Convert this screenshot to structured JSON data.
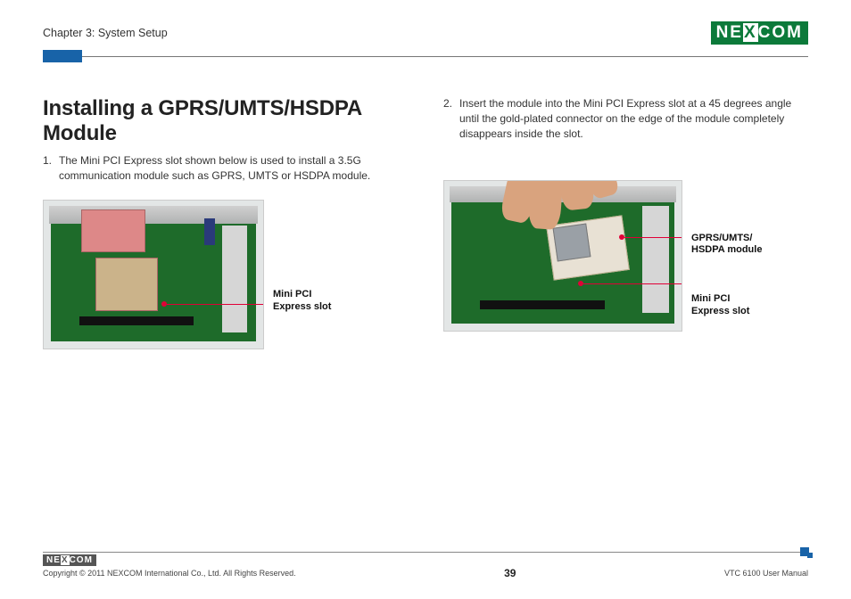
{
  "header": {
    "chapter": "Chapter 3: System Setup",
    "logo_left": "NE",
    "logo_x": "X",
    "logo_right": "COM"
  },
  "title": "Installing a GPRS/UMTS/HSDPA Module",
  "steps": [
    {
      "num": "1.",
      "text": "The Mini PCI Express slot shown below is used to install a 3.5G communication module such as GPRS, UMTS or HSDPA module."
    },
    {
      "num": "2.",
      "text": "Insert the module into the Mini PCI Express slot at a 45 degrees angle until the gold-plated connector on the edge of the module completely disappears inside the slot."
    }
  ],
  "callouts_fig1": {
    "slot": "Mini PCI\nExpress slot"
  },
  "callouts_fig2": {
    "module": "GPRS/UMTS/\nHSDPA module",
    "slot": "Mini PCI\nExpress slot"
  },
  "footer": {
    "copyright": "Copyright © 2011 NEXCOM International Co., Ltd. All Rights Reserved.",
    "page": "39",
    "doc": "VTC 6100 User Manual",
    "logo_left": "NE",
    "logo_x": "X",
    "logo_right": "COM"
  }
}
